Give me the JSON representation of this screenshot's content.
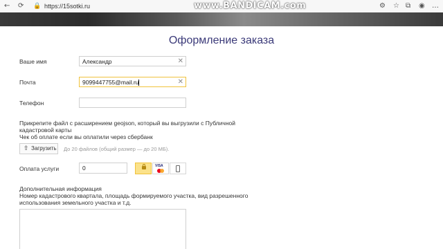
{
  "browser": {
    "url": "https://15sotki.ru",
    "watermark": "www.BANDICAM.com"
  },
  "form": {
    "title": "Оформление заказа",
    "name": {
      "label": "Ваше имя",
      "value": "Александр"
    },
    "email": {
      "label": "Почта",
      "value": "9099447755@mail.ru"
    },
    "phone": {
      "label": "Телефон",
      "value": ""
    },
    "attach_note": {
      "line1": "Прикрепите файл с расширением geojson, который вы выгрузили с Публичной",
      "line2": "кадастровой карты",
      "line3": "Чек об оплате если вы оплатили через сбербанк"
    },
    "upload": {
      "label": "Загрузить",
      "hint": "До 20 файлов (общий размер — до 20 МБ)."
    },
    "payment": {
      "label": "Оплата услуги",
      "value": "0",
      "methods": [
        "lock-icon",
        "visa-mastercard-icon",
        "phone-icon"
      ],
      "selected": 0
    },
    "additional": {
      "title": "Дополнительная информация",
      "line1": "Номер кадастрового квартала, площадь формируемого участка, вид разрешенного",
      "line2": "использования земельного участка и т.д."
    }
  },
  "colors": {
    "title": "#3b3a79",
    "accent": "#f0c23b"
  }
}
